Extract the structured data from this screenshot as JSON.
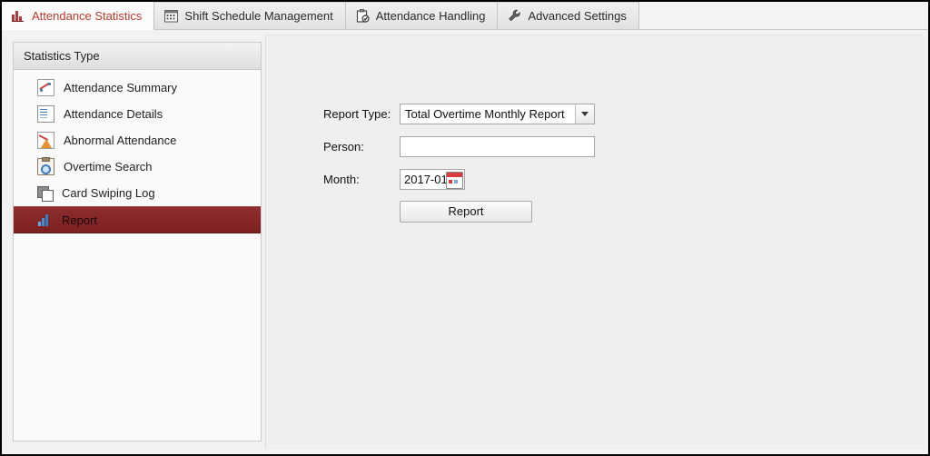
{
  "window": {
    "title": "Attendance Statistics"
  },
  "tabs": [
    {
      "label": "Attendance Statistics",
      "icon": "bar-chart-icon",
      "active": true
    },
    {
      "label": "Shift Schedule Management",
      "icon": "calendar-icon",
      "active": false
    },
    {
      "label": "Attendance Handling",
      "icon": "clipboard-check-icon",
      "active": false
    },
    {
      "label": "Advanced Settings",
      "icon": "wrench-icon",
      "active": false
    }
  ],
  "sidebar": {
    "header": "Statistics Type",
    "items": [
      {
        "label": "Attendance Summary",
        "icon": "chart-line-icon",
        "selected": false
      },
      {
        "label": "Attendance Details",
        "icon": "document-list-icon",
        "selected": false
      },
      {
        "label": "Abnormal Attendance",
        "icon": "warning-triangle-icon",
        "selected": false
      },
      {
        "label": "Overtime Search",
        "icon": "clipboard-search-icon",
        "selected": false
      },
      {
        "label": "Card Swiping Log",
        "icon": "card-stack-icon",
        "selected": false
      },
      {
        "label": "Report",
        "icon": "bar-chart-blue-icon",
        "selected": true
      }
    ]
  },
  "form": {
    "report_type": {
      "label": "Report Type:",
      "value": "Total Overtime Monthly Report",
      "options": [
        "Total Overtime Monthly Report"
      ]
    },
    "person": {
      "label": "Person:",
      "value": "",
      "placeholder": ""
    },
    "month": {
      "label": "Month:",
      "value": "2017-01",
      "icon": "calendar-icon"
    },
    "submit": {
      "label": "Report"
    }
  },
  "colors": {
    "accent_red": "#c0392b",
    "selected_row": "#7d2020",
    "content_bg": "#efefef",
    "panel_bg": "#fafafa"
  }
}
